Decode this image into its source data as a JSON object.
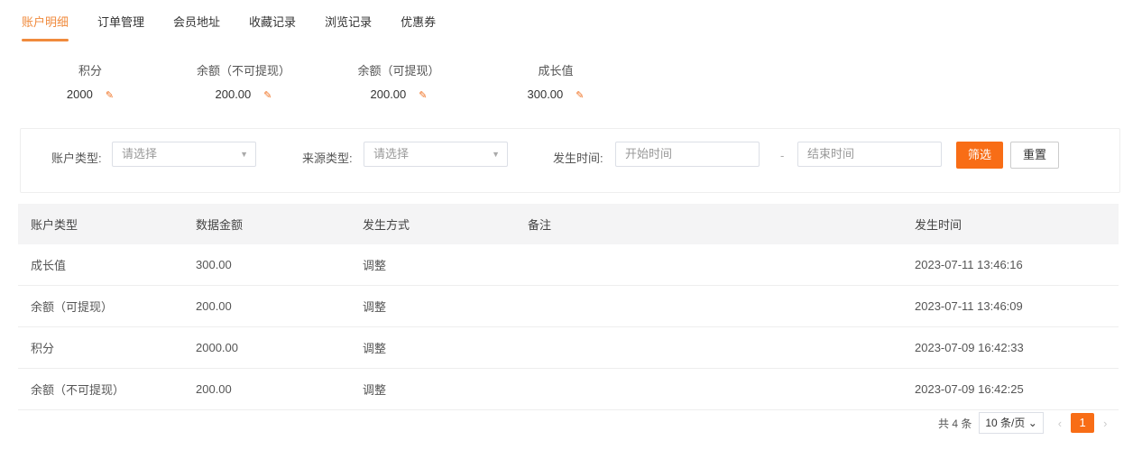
{
  "tabs": [
    "账户明细",
    "订单管理",
    "会员地址",
    "收藏记录",
    "浏览记录",
    "优惠券"
  ],
  "stats": [
    {
      "label": "积分",
      "value": "2000"
    },
    {
      "label": "余额（不可提现）",
      "value": "200.00"
    },
    {
      "label": "余额（可提现）",
      "value": "200.00"
    },
    {
      "label": "成长值",
      "value": "300.00"
    }
  ],
  "filter": {
    "account_type_label": "账户类型:",
    "account_type_placeholder": "请选择",
    "source_type_label": "来源类型:",
    "source_type_placeholder": "请选择",
    "time_label": "发生时间:",
    "start_placeholder": "开始时间",
    "separator": "-",
    "end_placeholder": "结束时间",
    "filter_button": "筛选",
    "reset_button": "重置"
  },
  "table": {
    "headers": [
      "账户类型",
      "数据金额",
      "发生方式",
      "备注",
      "发生时间"
    ],
    "rows": [
      [
        "成长值",
        "300.00",
        "调整",
        "",
        "2023-07-11 13:46:16"
      ],
      [
        "余额（可提现）",
        "200.00",
        "调整",
        "",
        "2023-07-11 13:46:09"
      ],
      [
        "积分",
        "2000.00",
        "调整",
        "",
        "2023-07-09 16:42:33"
      ],
      [
        "余额（不可提现）",
        "200.00",
        "调整",
        "",
        "2023-07-09 16:42:25"
      ]
    ]
  },
  "pagination": {
    "total": "共 4 条",
    "page_size": "10 条/页",
    "current_page": "1",
    "prev": "‹",
    "next": "›"
  }
}
